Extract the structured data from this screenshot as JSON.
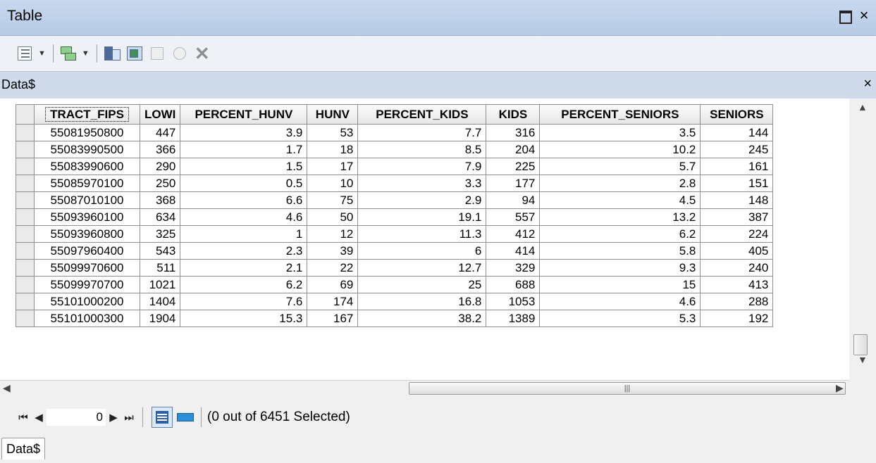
{
  "window": {
    "title": "Table"
  },
  "tab": {
    "label": "Data$",
    "close_symbol": "×"
  },
  "grid": {
    "columns": [
      "TRACT_FIPS",
      "LOWI",
      "PERCENT_HUNV",
      "HUNV",
      "PERCENT_KIDS",
      "KIDS",
      "PERCENT_SENIORS",
      "SENIORS"
    ],
    "rows": [
      [
        "55081950800",
        "447",
        "3.9",
        "53",
        "7.7",
        "316",
        "3.5",
        "144"
      ],
      [
        "55083990500",
        "366",
        "1.7",
        "18",
        "8.5",
        "204",
        "10.2",
        "245"
      ],
      [
        "55083990600",
        "290",
        "1.5",
        "17",
        "7.9",
        "225",
        "5.7",
        "161"
      ],
      [
        "55085970100",
        "250",
        "0.5",
        "10",
        "3.3",
        "177",
        "2.8",
        "151"
      ],
      [
        "55087010100",
        "368",
        "6.6",
        "75",
        "2.9",
        "94",
        "4.5",
        "148"
      ],
      [
        "55093960100",
        "634",
        "4.6",
        "50",
        "19.1",
        "557",
        "13.2",
        "387"
      ],
      [
        "55093960800",
        "325",
        "1",
        "12",
        "11.3",
        "412",
        "6.2",
        "224"
      ],
      [
        "55097960400",
        "543",
        "2.3",
        "39",
        "6",
        "414",
        "5.8",
        "405"
      ],
      [
        "55099970600",
        "511",
        "2.1",
        "22",
        "12.7",
        "329",
        "9.3",
        "240"
      ],
      [
        "55099970700",
        "1021",
        "6.2",
        "69",
        "25",
        "688",
        "15",
        "413"
      ],
      [
        "55101000200",
        "1404",
        "7.6",
        "174",
        "16.8",
        "1053",
        "4.6",
        "288"
      ],
      [
        "55101000300",
        "1904",
        "15.3",
        "167",
        "38.2",
        "1389",
        "5.3",
        "192"
      ]
    ]
  },
  "nav": {
    "current_record": "0",
    "status": "(0 out of 6451 Selected)"
  },
  "bottom_tab": {
    "label": "Data$"
  },
  "icons": {
    "first": "first-record-icon",
    "prev": "previous-record-icon",
    "next": "next-record-icon",
    "last": "last-record-icon"
  },
  "colors": {
    "title_bar": "#c9d8ee",
    "tab_strip": "#cfdbeb",
    "selected_view": "#2a5ea8"
  }
}
